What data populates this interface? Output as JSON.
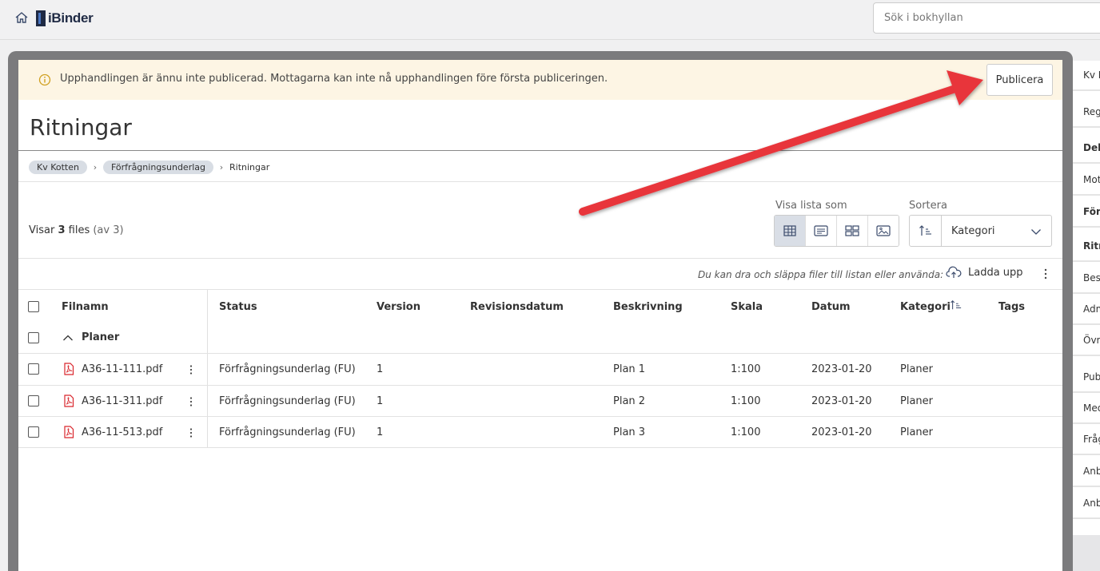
{
  "app": {
    "logo_text": "iBinder",
    "search_placeholder": "Sök i bokhyllan"
  },
  "notice": {
    "text": "Upphandlingen är ännu inte publicerad. Mottagarna kan inte nå upphandlingen före första publiceringen.",
    "publish_label": "Publicera"
  },
  "page": {
    "title": "Ritningar",
    "breadcrumb": [
      "Kv Kotten",
      "Förfrågningsunderlag",
      "Ritningar"
    ]
  },
  "toolbar": {
    "count_prefix": "Visar",
    "count_value": "3",
    "count_unit": "files",
    "count_total": "(av 3)",
    "view_label": "Visa lista som",
    "sort_label": "Sortera",
    "sort_value": "Kategori",
    "drop_hint": "Du kan dra och släppa filer till listan eller använda:",
    "upload_label": "Ladda upp"
  },
  "table": {
    "headers": [
      "Filnamn",
      "Status",
      "Version",
      "Revisionsdatum",
      "Beskrivning",
      "Skala",
      "Datum",
      "Kategori",
      "Tags"
    ],
    "group_label": "Planer",
    "rows": [
      {
        "filename": "A36-11-111.pdf",
        "status": "Förfrågningsunderlag (FU)",
        "version": "1",
        "revision": "",
        "description": "Plan 1",
        "scale": "1:100",
        "date": "2023-01-20",
        "category": "Planer",
        "tags": ""
      },
      {
        "filename": "A36-11-311.pdf",
        "status": "Förfrågningsunderlag (FU)",
        "version": "1",
        "revision": "",
        "description": "Plan 2",
        "scale": "1:100",
        "date": "2023-01-20",
        "category": "Planer",
        "tags": ""
      },
      {
        "filename": "A36-11-513.pdf",
        "status": "Förfrågningsunderlag (FU)",
        "version": "1",
        "revision": "",
        "description": "Plan 3",
        "scale": "1:100",
        "date": "2023-01-20",
        "category": "Planer",
        "tags": ""
      }
    ]
  },
  "side_panel": {
    "items": [
      {
        "label": "Kv K",
        "bold": false
      },
      {
        "label": "Reg",
        "bold": false
      },
      {
        "label": "Del",
        "bold": true
      },
      {
        "label": "Mot",
        "bold": false
      },
      {
        "label": "För",
        "bold": true
      },
      {
        "label": "Ritn",
        "bold": true
      },
      {
        "label": "Bes",
        "bold": false
      },
      {
        "label": "Adm",
        "bold": false
      },
      {
        "label": "Övr",
        "bold": false
      },
      {
        "label": "Pub",
        "bold": false
      },
      {
        "label": "Med",
        "bold": false
      },
      {
        "label": "Fråg",
        "bold": false
      },
      {
        "label": "Anb",
        "bold": false
      },
      {
        "label": "Anb",
        "bold": false
      }
    ]
  },
  "colors": {
    "notice_bg": "#fdf5e4",
    "arrow": "#e8343a",
    "pdf_icon": "#d9262c",
    "active_view": "#d9dee6"
  }
}
